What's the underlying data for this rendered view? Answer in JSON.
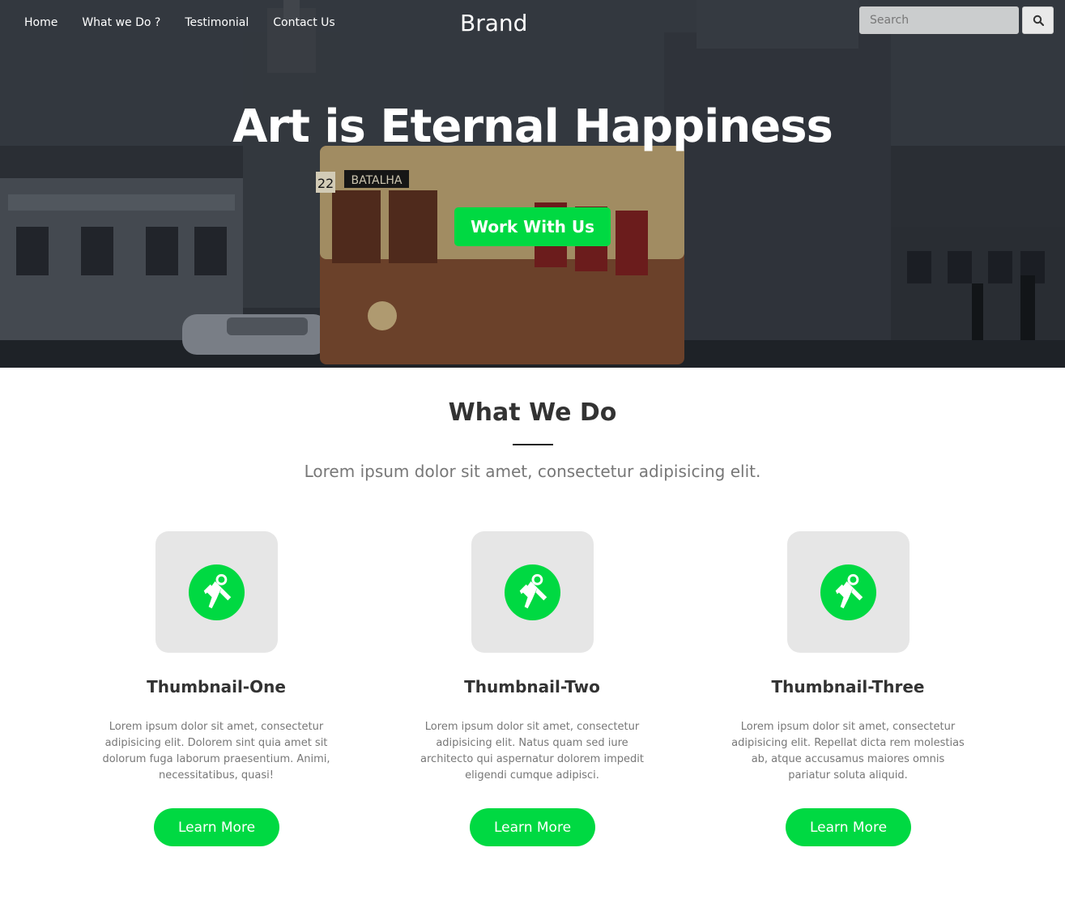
{
  "nav": {
    "links": [
      "Home",
      "What we Do ?",
      "Testimonial",
      "Contact Us"
    ],
    "brand": "Brand",
    "search_placeholder": "Search"
  },
  "hero": {
    "title": "Art is Eternal Happiness",
    "cta_label": "Work With Us",
    "tram_sign": "BATALHA",
    "tram_number": "22"
  },
  "what_we_do": {
    "title": "What We Do",
    "subtitle": "Lorem ipsum dolor sit amet, consectetur adipisicing elit.",
    "cards": [
      {
        "title": "Thumbnail-One",
        "text": "Lorem ipsum dolor sit amet, consectetur adipisicing elit. Dolorem sint quia amet sit dolorum fuga laborum praesentium. Animi, necessitatibus, quasi!",
        "button": "Learn More"
      },
      {
        "title": "Thumbnail-Two",
        "text": "Lorem ipsum dolor sit amet, consectetur adipisicing elit. Natus quam sed iure architecto qui aspernatur dolorem impedit eligendi cumque adipisci.",
        "button": "Learn More"
      },
      {
        "title": "Thumbnail-Three",
        "text": "Lorem ipsum dolor sit amet, consectetur adipisicing elit. Repellat dicta rem molestias ab, atque accusamus maiores omnis pariatur soluta aliquid.",
        "button": "Learn More"
      }
    ]
  },
  "colors": {
    "accent": "#00d942",
    "thumb_bg": "#e6e6e6",
    "hero_dark": "#2c3138"
  },
  "icons": {
    "search": "search-icon",
    "card": "astronaut-icon"
  }
}
